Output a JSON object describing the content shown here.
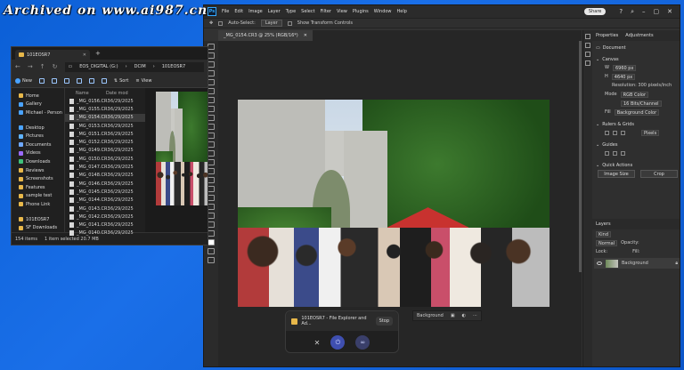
{
  "watermark": "Archived on www.ai987.cn",
  "explorer": {
    "tab_title": "101EOSR7",
    "address": [
      "EOS_DIGITAL (G:)",
      "DCIM",
      "101EOSR7"
    ],
    "new_label": "New",
    "sort_label": "Sort",
    "view_label": "View",
    "sidebar": [
      {
        "label": "Home",
        "color": "#e8b84a"
      },
      {
        "label": "Gallery",
        "color": "#4aa3ff"
      },
      {
        "label": "Michael - Person",
        "color": "#4aa3ff"
      },
      {
        "label": "Desktop",
        "color": "#4aa3ff"
      },
      {
        "label": "Pictures",
        "color": "#5fb3ff"
      },
      {
        "label": "Documents",
        "color": "#6ea8ff"
      },
      {
        "label": "Videos",
        "color": "#9b6bff"
      },
      {
        "label": "Downloads",
        "color": "#3fc17a"
      },
      {
        "label": "Reviews",
        "color": "#e8b84a"
      },
      {
        "label": "Screenshots",
        "color": "#e8b84a"
      },
      {
        "label": "Features",
        "color": "#e8b84a"
      },
      {
        "label": "sample test",
        "color": "#e8b84a"
      },
      {
        "label": "Phone Link",
        "color": "#e8b84a"
      },
      {
        "label": "101EOSR7",
        "color": "#e8b84a"
      },
      {
        "label": "SF Downloads",
        "color": "#e8b84a"
      }
    ],
    "columns": [
      "Name",
      "Date mod"
    ],
    "files": [
      {
        "name": "_MG_0156.CR3",
        "date": "6/29/2025"
      },
      {
        "name": "_MG_0155.CR3",
        "date": "6/29/2025"
      },
      {
        "name": "_MG_0154.CR3",
        "date": "6/29/2025"
      },
      {
        "name": "_MG_0153.CR3",
        "date": "6/29/2025"
      },
      {
        "name": "_MG_0151.CR3",
        "date": "6/29/2025"
      },
      {
        "name": "_MG_0152.CR3",
        "date": "6/29/2025"
      },
      {
        "name": "_MG_0149.CR3",
        "date": "6/29/2025"
      },
      {
        "name": "_MG_0150.CR3",
        "date": "6/29/2025"
      },
      {
        "name": "_MG_0147.CR3",
        "date": "6/29/2025"
      },
      {
        "name": "_MG_0148.CR3",
        "date": "6/29/2025"
      },
      {
        "name": "_MG_0146.CR3",
        "date": "6/29/2025"
      },
      {
        "name": "_MG_0145.CR3",
        "date": "6/29/2025"
      },
      {
        "name": "_MG_0144.CR3",
        "date": "6/29/2025"
      },
      {
        "name": "_MG_0143.CR3",
        "date": "6/29/2025"
      },
      {
        "name": "_MG_0142.CR3",
        "date": "6/29/2025"
      },
      {
        "name": "_MG_0141.CR3",
        "date": "6/29/2025"
      },
      {
        "name": "_MG_0140.CR3",
        "date": "6/29/2025"
      }
    ],
    "status_items": "154 items",
    "status_selected": "1 item selected 20.7 MB"
  },
  "photoshop": {
    "menu": [
      "File",
      "Edit",
      "Image",
      "Layer",
      "Type",
      "Select",
      "Filter",
      "View",
      "Plugins",
      "Window",
      "Help"
    ],
    "share_label": "Share",
    "options": {
      "auto_select": "Auto-Select:",
      "layer": "Layer",
      "show_transform": "Show Transform Controls"
    },
    "doc_tab": "_MG_0154.CR3 @ 25% (RGB/16*)",
    "context_bar_label": "Background",
    "properties": {
      "tabs": [
        "Properties",
        "Adjustments"
      ],
      "document_label": "Document",
      "canvas_label": "Canvas",
      "width_value": "6960 px",
      "height_value": "4640 px",
      "resolution": "Resolution: 300 pixels/inch",
      "mode_label": "Mode",
      "mode_value": "RGB Color",
      "bit_depth": "16 Bits/Channel",
      "fill_label": "Fill",
      "fill_value": "Background Color",
      "rulers_label": "Rulers & Grids",
      "units_value": "Pixels",
      "guides_label": "Guides",
      "quick_actions_label": "Quick Actions",
      "image_size_label": "Image Size",
      "crop_label": "Crop"
    },
    "layers": {
      "title": "Layers",
      "kind": "Kind",
      "blend": "Normal",
      "opacity": "Opacity:",
      "lock": "Lock:",
      "fill": "Fill:",
      "layer_name": "Background"
    }
  },
  "popup": {
    "title": "101EOSR7 - File Explorer and Ad...",
    "stop_label": "Stop"
  }
}
